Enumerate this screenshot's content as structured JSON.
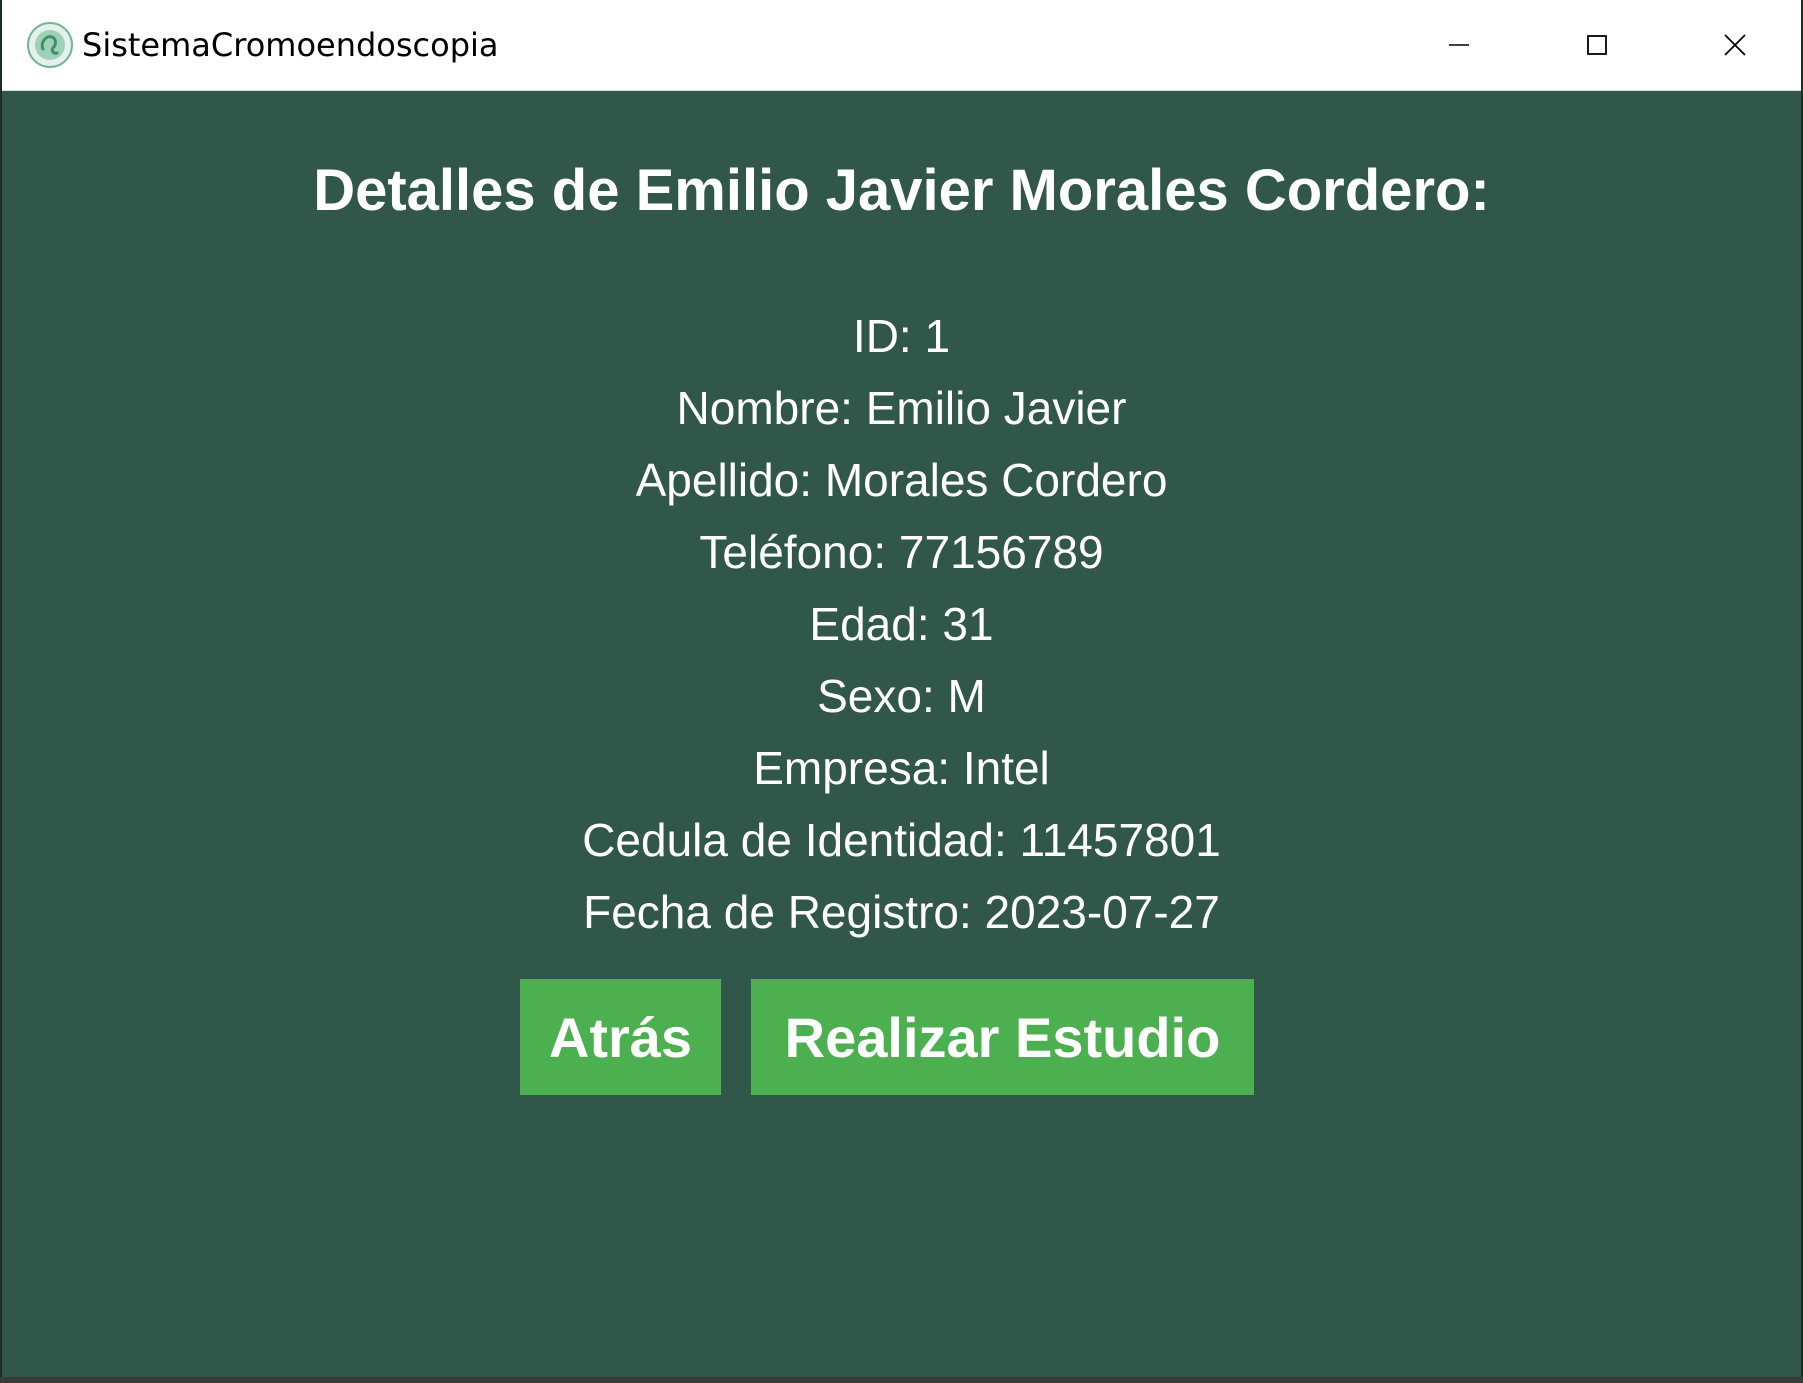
{
  "window": {
    "title": "SistemaCromoendoscopia",
    "controls": {
      "minimize": "minimize-icon",
      "maximize": "maximize-icon",
      "close": "close-icon"
    }
  },
  "patient": {
    "heading": "Detalles de Emilio Javier Morales Cordero:",
    "details": [
      "ID: 1",
      "Nombre: Emilio Javier",
      "Apellido: Morales Cordero",
      "Teléfono: 77156789",
      "Edad: 31",
      "Sexo: M",
      "Empresa: Intel",
      "Cedula de Identidad: 11457801",
      "Fecha de Registro: 2023-07-27"
    ]
  },
  "actions": {
    "back_label": "Atrás",
    "study_label": "Realizar Estudio"
  },
  "colors": {
    "background": "#31564a",
    "button": "#4caf50",
    "text": "#ffffff"
  }
}
